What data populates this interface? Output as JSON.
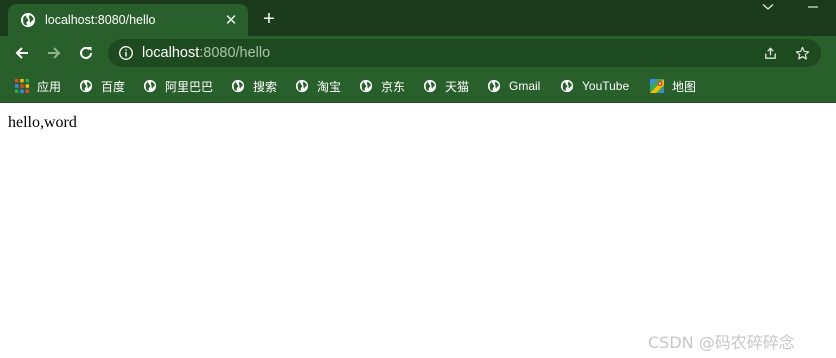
{
  "browser": {
    "tab": {
      "title": "localhost:8080/hello",
      "favicon": "globe-icon",
      "close_glyph": "✕"
    },
    "new_tab_glyph": "+",
    "window_controls": [
      "chevron-down-icon",
      "minimize-icon"
    ],
    "toolbar": {
      "back": "back-arrow-icon",
      "forward": "forward-arrow-icon",
      "reload": "reload-icon",
      "site_info": "info-icon",
      "url_host": "localhost",
      "url_rest": ":8080/hello",
      "share": "share-icon",
      "bookmark": "star-icon"
    },
    "bookmarks": [
      {
        "label": "应用",
        "icon": "apps-grid-icon"
      },
      {
        "label": "百度",
        "icon": "globe-icon"
      },
      {
        "label": "阿里巴巴",
        "icon": "globe-icon"
      },
      {
        "label": "搜索",
        "icon": "globe-icon"
      },
      {
        "label": "淘宝",
        "icon": "globe-icon"
      },
      {
        "label": "京东",
        "icon": "globe-icon"
      },
      {
        "label": "天猫",
        "icon": "globe-icon"
      },
      {
        "label": "Gmail",
        "icon": "globe-icon"
      },
      {
        "label": "YouTube",
        "icon": "globe-icon"
      },
      {
        "label": "地图",
        "icon": "maps-icon"
      }
    ]
  },
  "page": {
    "body_text": "hello,word"
  },
  "watermark": "CSDN @码农碎碎念",
  "colors": {
    "title_bar": "#1b3a1b",
    "toolbar": "#285f2a",
    "omnibox": "#1e4a20",
    "page_bg": "#ffffff"
  }
}
